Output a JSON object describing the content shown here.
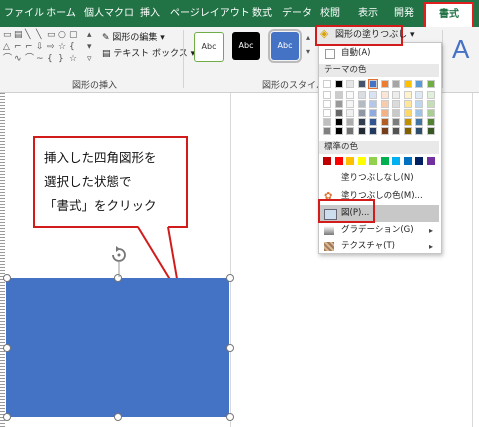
{
  "tabs": [
    {
      "label": "ファイル",
      "active": false
    },
    {
      "label": "ホーム",
      "active": false
    },
    {
      "label": "個人マクロ",
      "active": false
    },
    {
      "label": "挿入",
      "active": false
    },
    {
      "label": "ページレイアウト",
      "active": false
    },
    {
      "label": "数式",
      "active": false
    },
    {
      "label": "データ",
      "active": false
    },
    {
      "label": "校閲",
      "active": false
    },
    {
      "label": "表示",
      "active": false
    },
    {
      "label": "開発",
      "active": false
    },
    {
      "label": "書式",
      "active": true
    }
  ],
  "ribbon": {
    "edit_shape": "図形の編集 ▾",
    "text_box": "テキスト ボックス ▾",
    "group_insert": "図形の挿入",
    "group_style": "図形のスタイル",
    "style_thumbs": [
      "Abc",
      "Abc",
      "Abc"
    ],
    "fill_button": "図形の塗りつぶし ▾",
    "big_letter": "A"
  },
  "menu": {
    "auto": "自動(A)",
    "theme_header": "テーマの色",
    "standard_header": "標準の色",
    "no_fill": "塗りつぶしなし(N)",
    "more_colors": "塗りつぶしの色(M)...",
    "picture": "図(P)...",
    "gradient": "グラデーション(G)",
    "texture": "テクスチャ(T)",
    "submenu_arrow": "▸",
    "theme_row": [
      "#ffffff",
      "#000000",
      "#e7e6e6",
      "#44546a",
      "#4472c4",
      "#ed7d31",
      "#a5a5a5",
      "#ffc000",
      "#5b9bd5",
      "#70ad47"
    ],
    "standard_row": [
      "#c00000",
      "#ff0000",
      "#ffc000",
      "#ffff00",
      "#92d050",
      "#00b050",
      "#00b0f0",
      "#0070c0",
      "#002060",
      "#7030a0"
    ]
  },
  "callout": {
    "lines": [
      "挿入した四角図形を",
      "選択した状態で",
      "「書式」をクリック"
    ]
  },
  "shape_color": "#4472c4",
  "accent": "#217346",
  "highlight_color": "#d21c1c"
}
